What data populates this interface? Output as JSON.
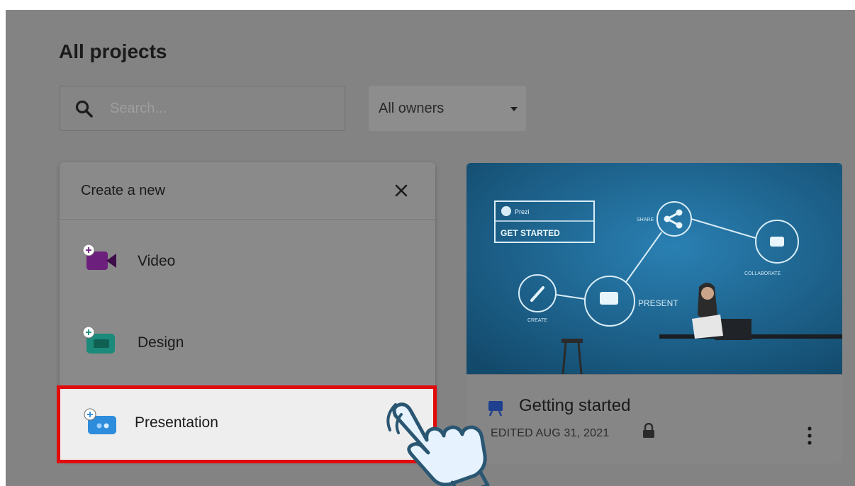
{
  "header": {
    "title": "All projects"
  },
  "search": {
    "placeholder": "Search..."
  },
  "owner_filter": {
    "selected": "All owners"
  },
  "create_panel": {
    "title": "Create a new",
    "items": [
      {
        "label": "Video",
        "icon": "video-camera-icon",
        "color": "#6c1f7d"
      },
      {
        "label": "Design",
        "icon": "design-icon",
        "color": "#1b8a7a"
      },
      {
        "label": "Presentation",
        "icon": "presentation-icon",
        "color": "#2d8cdb"
      }
    ]
  },
  "project_card": {
    "title": "Getting started",
    "edited": "EDITED AUG 31, 2021",
    "thumbnail": {
      "badge_brand": "Prezi",
      "badge_text": "GET STARTED",
      "node_labels": [
        "SHARE",
        "COLLABORATE",
        "CREATE",
        "PRESENT"
      ]
    }
  },
  "colors": {
    "highlight_border": "#e20b0b",
    "thumbnail_blue": "#1f6c9a",
    "overlay_gray": "#838383",
    "presentation_icon": "#2d8cdb"
  }
}
